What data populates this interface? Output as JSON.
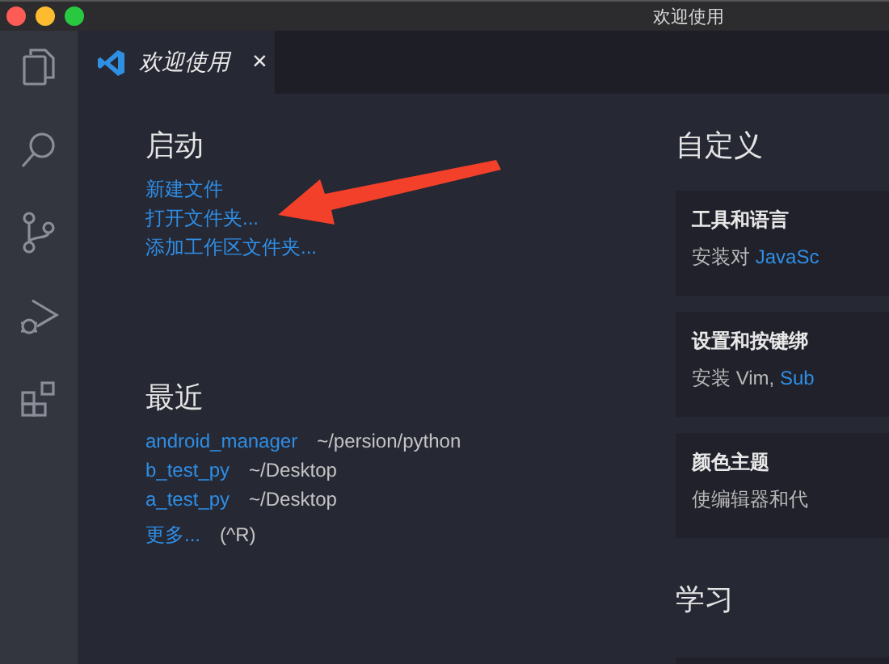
{
  "window": {
    "title": "欢迎使用"
  },
  "activity_bar": [
    {
      "kind": "files"
    },
    {
      "kind": "search"
    },
    {
      "kind": "source-control"
    },
    {
      "kind": "debug"
    },
    {
      "kind": "extensions"
    }
  ],
  "tabs": [
    {
      "label": "欢迎使用",
      "close": "×",
      "selected": true
    }
  ],
  "start": {
    "heading": "启动",
    "links": [
      "新建文件",
      "打开文件夹...",
      "添加工作区文件夹..."
    ]
  },
  "recent": {
    "heading": "最近",
    "items": [
      {
        "name": "android_manager",
        "path": "~/persion/python"
      },
      {
        "name": "b_test_py",
        "path": "~/Desktop"
      },
      {
        "name": "a_test_py",
        "path": "~/Desktop"
      }
    ],
    "more": {
      "label": "更多...",
      "shortcut": "(^R)"
    }
  },
  "customize": {
    "heading": "自定义",
    "cards": [
      {
        "title": "工具和语言",
        "text": "安装对 ",
        "link": "JavaSc"
      },
      {
        "title": "设置和按键绑",
        "text": "安装 Vim, ",
        "link": "Sub"
      },
      {
        "title": "颜色主题",
        "text": "使编辑器和代"
      }
    ]
  },
  "learn": {
    "heading": "学习"
  }
}
